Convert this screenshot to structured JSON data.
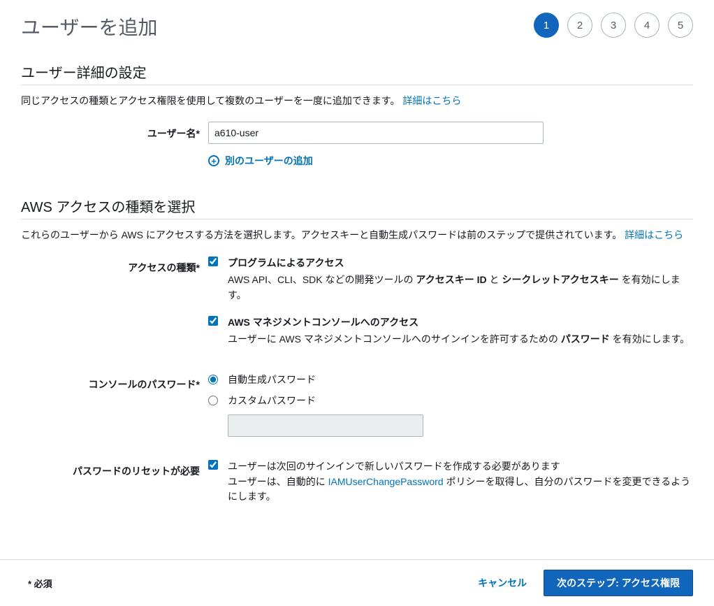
{
  "page_title": "ユーザーを追加",
  "steps": [
    "1",
    "2",
    "3",
    "4",
    "5"
  ],
  "active_step": 1,
  "section1": {
    "title": "ユーザー詳細の設定",
    "desc": "同じアクセスの種類とアクセス権限を使用して複数のユーザーを一度に追加できます。",
    "learn_more": "詳細はこちら",
    "username_label": "ユーザー名*",
    "username_value": "a610-user",
    "add_user": "別のユーザーの追加"
  },
  "section2": {
    "title": "AWS アクセスの種類を選択",
    "desc": "これらのユーザーから AWS にアクセスする方法を選択します。アクセスキーと自動生成パスワードは前のステップで提供されています。",
    "learn_more": "詳細はこちら",
    "access_type_label": "アクセスの種類*",
    "programmatic": {
      "title": "プログラムによるアクセス",
      "desc_pre": "AWS API、CLI、SDK などの開発ツールの ",
      "bold1": "アクセスキー ID",
      "mid": " と ",
      "bold2": "シークレットアクセスキー",
      "desc_post": " を有効にします。",
      "checked": true
    },
    "console": {
      "title": "AWS マネジメントコンソールへのアクセス",
      "desc_pre": "ユーザーに AWS マネジメントコンソールへのサインインを許可するための ",
      "bold1": "パスワード",
      "desc_post": " を有効にします。",
      "checked": true
    },
    "console_password_label": "コンソールのパスワード*",
    "password_auto": "自動生成パスワード",
    "password_custom": "カスタムパスワード",
    "password_selected": "auto",
    "reset_label": "パスワードのリセットが必要",
    "reset_checked": true,
    "reset_line1": "ユーザーは次回のサインインで新しいパスワードを作成する必要があります",
    "reset_line2_pre": "ユーザーは、自動的に ",
    "reset_policy": "IAMUserChangePassword",
    "reset_line2_post": " ポリシーを取得し、自分のパスワードを変更できるようにします。"
  },
  "footer": {
    "required": "* 必須",
    "cancel": "キャンセル",
    "next": "次のステップ: アクセス権限"
  }
}
